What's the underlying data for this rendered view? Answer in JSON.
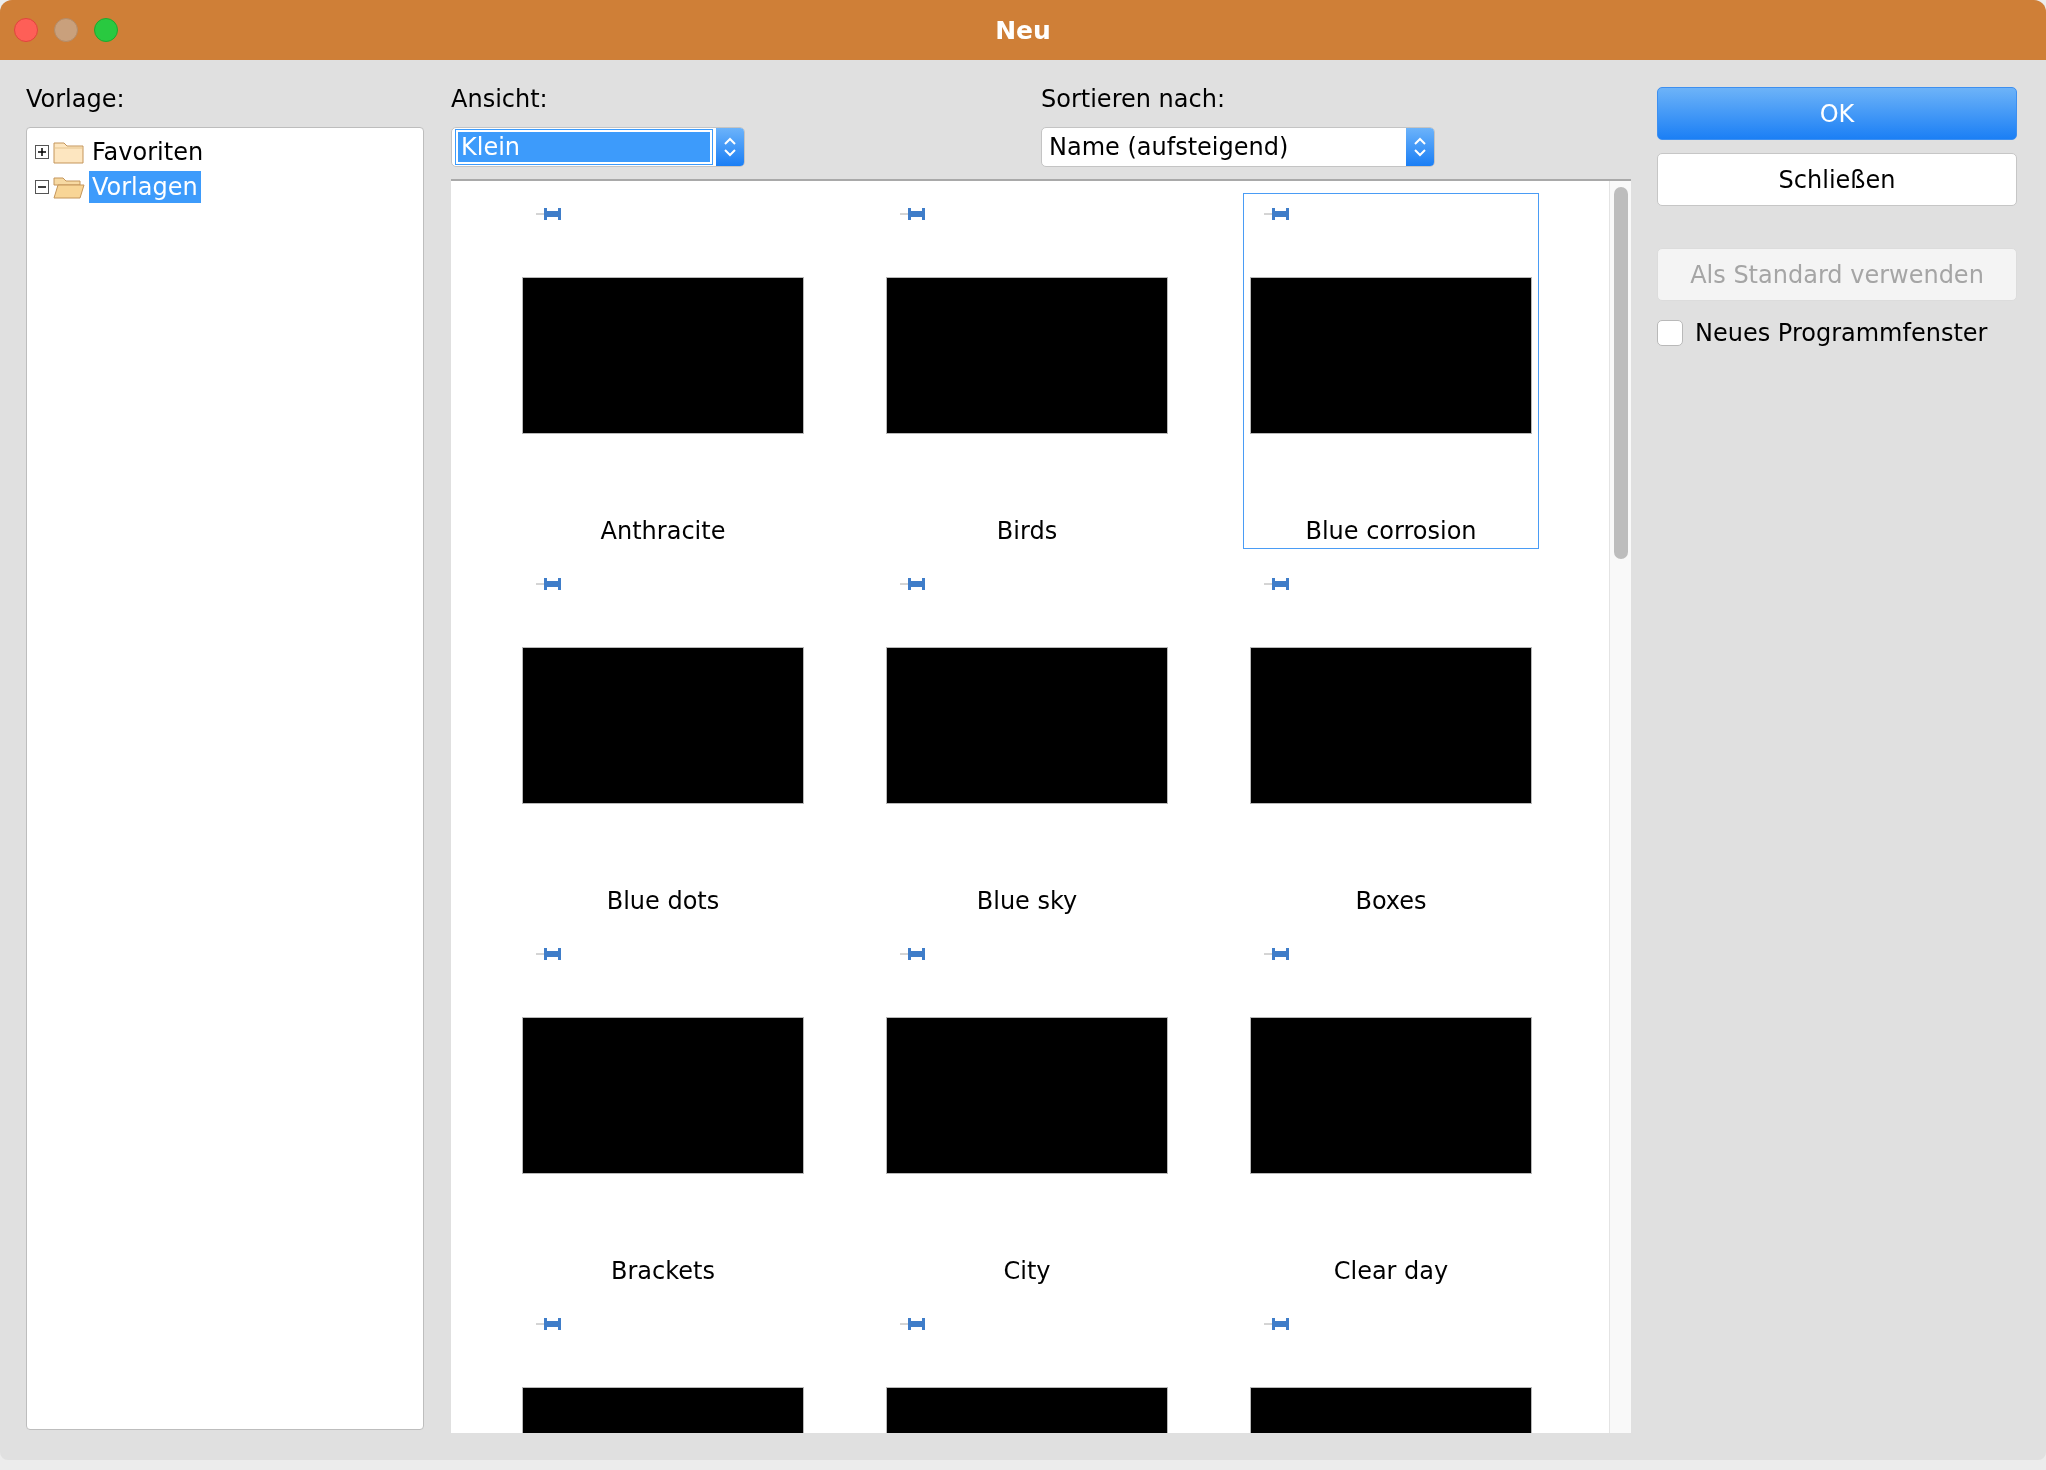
{
  "window": {
    "title": "Neu"
  },
  "template_tree": {
    "label": "Vorlage:",
    "items": [
      {
        "label": "Favoriten",
        "expanded": false,
        "selected": false
      },
      {
        "label": "Vorlagen",
        "expanded": true,
        "selected": true
      }
    ]
  },
  "view": {
    "label": "Ansicht:",
    "value": "Klein",
    "focused": true
  },
  "sort": {
    "label": "Sortieren nach:",
    "value": "Name (aufsteigend)",
    "focused": false
  },
  "templates": [
    {
      "label": "Anthracite",
      "selected": false
    },
    {
      "label": "Birds",
      "selected": false
    },
    {
      "label": "Blue corrosion",
      "selected": true
    },
    {
      "label": "Blue dots",
      "selected": false
    },
    {
      "label": "Blue sky",
      "selected": false
    },
    {
      "label": "Boxes",
      "selected": false
    },
    {
      "label": "Brackets",
      "selected": false
    },
    {
      "label": "City",
      "selected": false
    },
    {
      "label": "Clear day",
      "selected": false
    },
    {
      "selected": false
    },
    {
      "selected": false
    },
    {
      "selected": false
    }
  ],
  "buttons": [
    {
      "label": "OK",
      "default": true,
      "disabled": false
    },
    {
      "label": "Schließen",
      "default": false,
      "disabled": false
    },
    {
      "label": "Als Standard verwenden",
      "default": false,
      "disabled": true
    }
  ],
  "new_window_checkbox": {
    "label": "Neues Programmfenster",
    "checked": false
  }
}
